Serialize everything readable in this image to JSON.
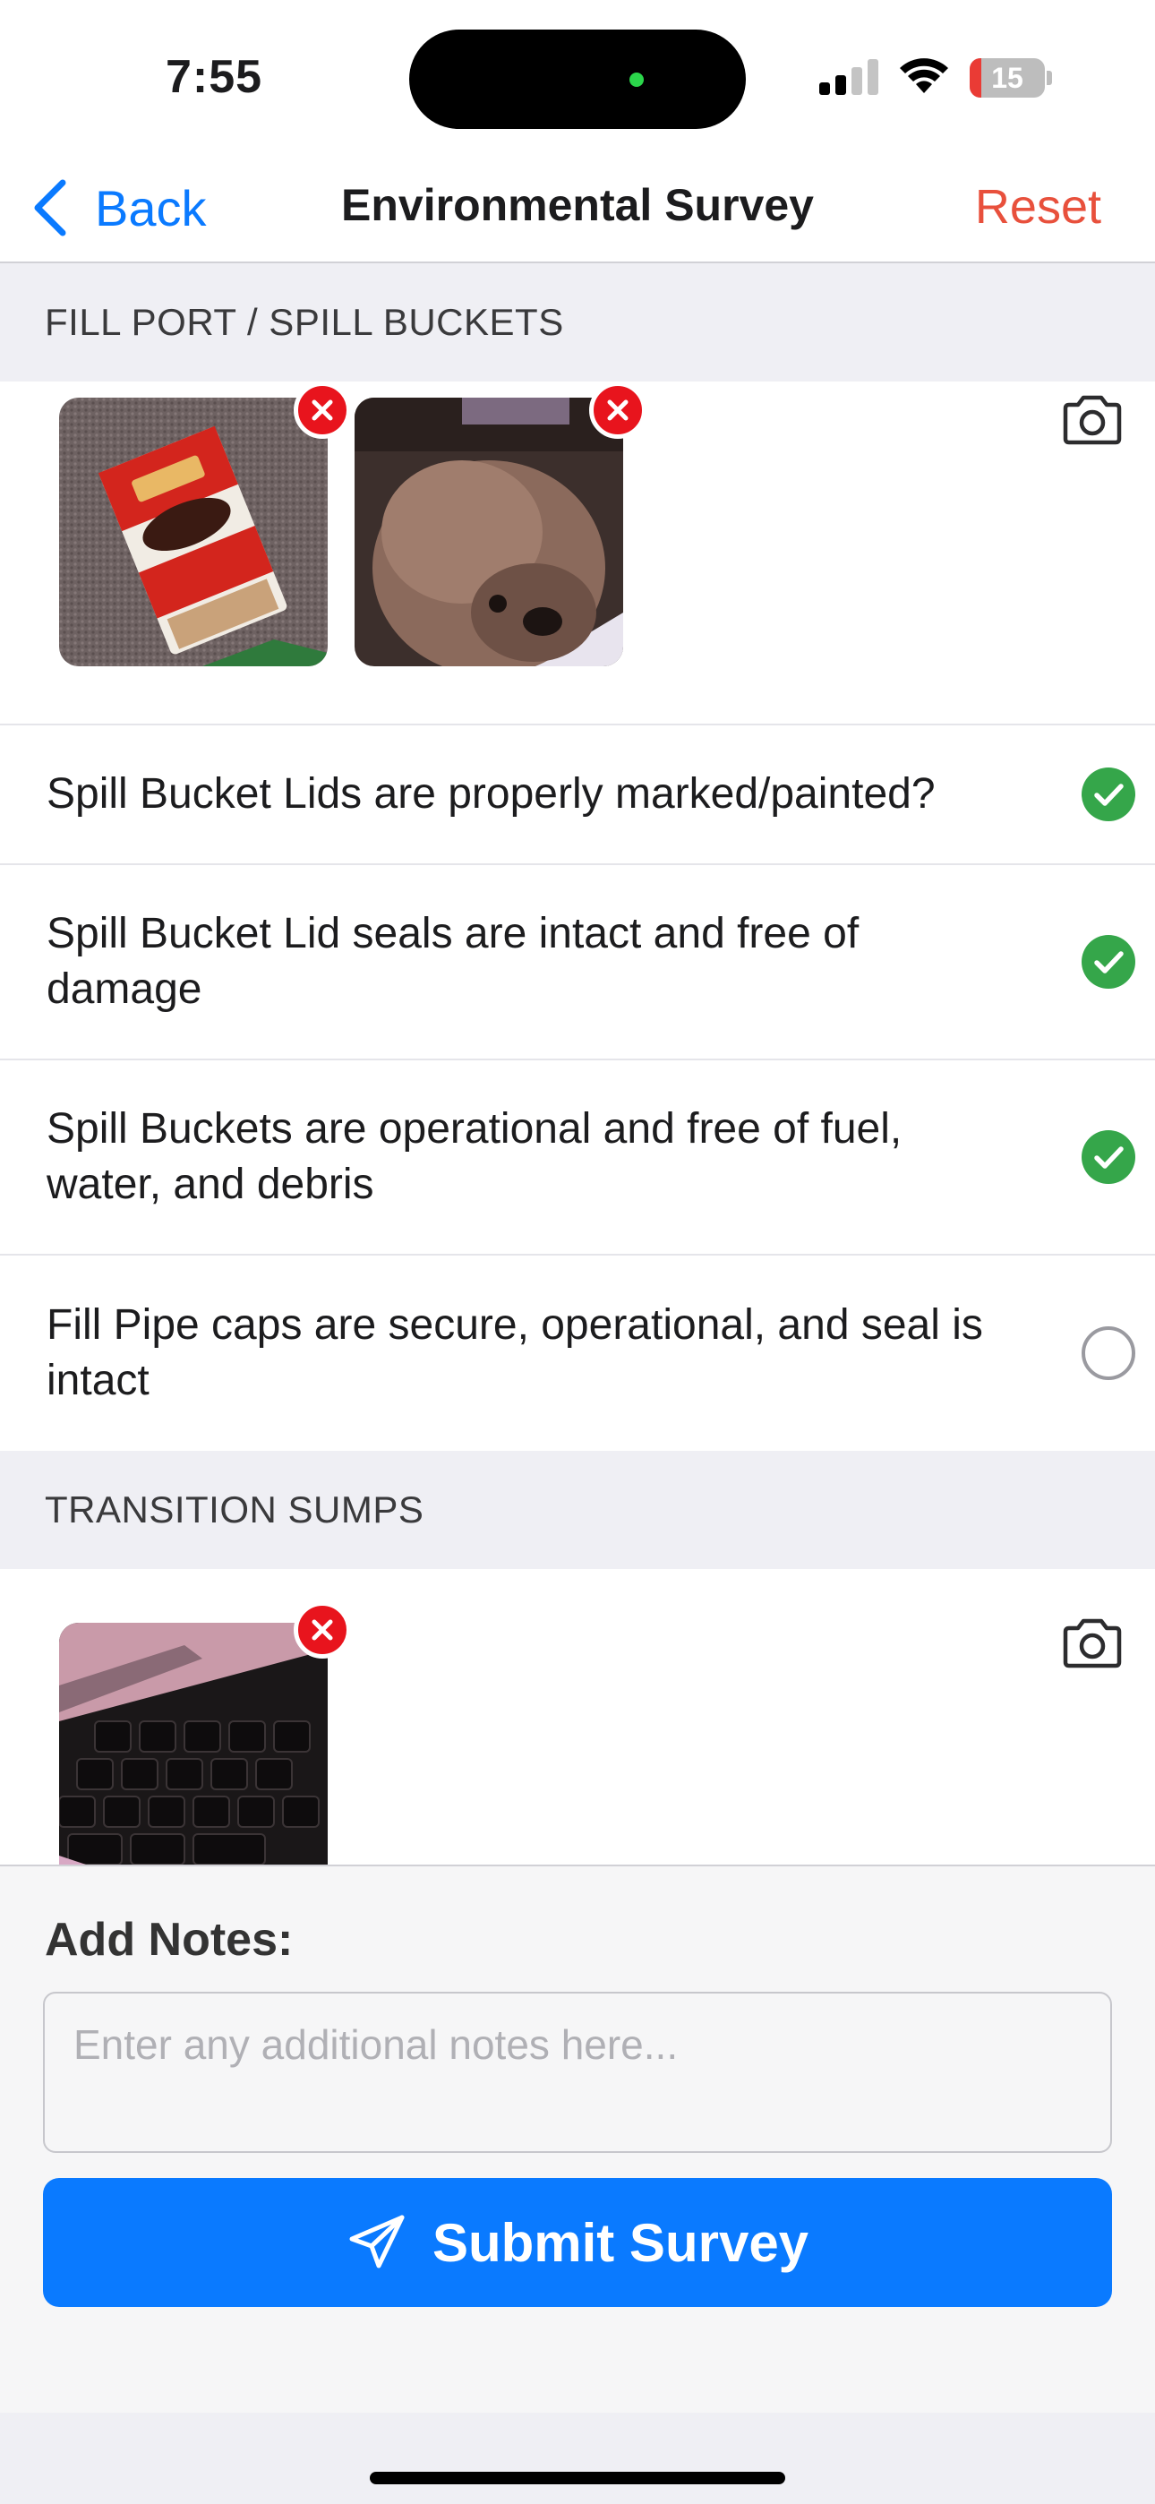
{
  "status_bar": {
    "time": "7:55",
    "battery_level": "15",
    "battery_fraction": 0.15
  },
  "nav": {
    "back_label": "Back",
    "title": "Environmental Survey",
    "reset_label": "Reset"
  },
  "sections": [
    {
      "header": "FILL PORT / SPILL BUCKETS",
      "photos": [
        "photo-nutella-snack",
        "photo-dog"
      ],
      "items": [
        {
          "text": "Spill Bucket Lids are properly marked/painted?",
          "checked": true
        },
        {
          "text": "Spill Bucket Lid seals are intact and free of damage",
          "checked": true
        },
        {
          "text": "Spill Buckets are operational and free of fuel, water, and debris",
          "checked": true
        },
        {
          "text": "Fill Pipe caps are secure, operational, and seal is intact",
          "checked": false
        }
      ]
    },
    {
      "header": "TRANSITION SUMPS",
      "photos": [
        "photo-laptop-keyboard"
      ]
    }
  ],
  "footer": {
    "notes_label": "Add Notes:",
    "notes_placeholder": "Enter any additional notes here...",
    "notes_value": "",
    "submit_label": "Submit Survey"
  },
  "colors": {
    "accent": "#0a7aff",
    "reset": "#e8503c",
    "checked": "#35a64a",
    "remove": "#e8141d",
    "section_bg": "#efeff4"
  },
  "icons": [
    "chevron-left-icon",
    "camera-icon",
    "close-icon",
    "checkmark-icon",
    "paper-plane-icon"
  ]
}
